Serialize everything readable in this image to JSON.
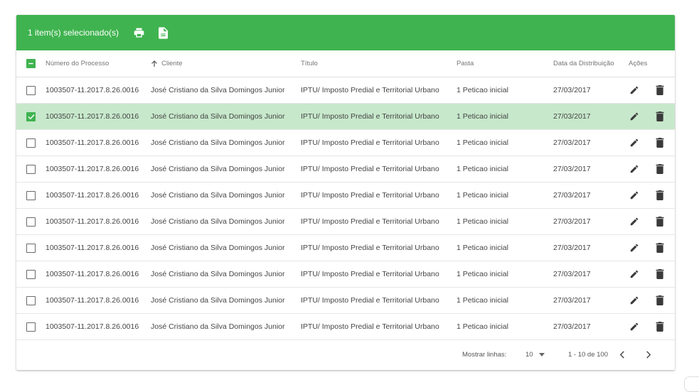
{
  "toolbar": {
    "selected_text": "1 item(s) selecionado(s)",
    "print_icon": "printer-icon",
    "doc_icon": "document-icon",
    "bg_color": "#3fb34f"
  },
  "table": {
    "columns": [
      "Número do Processo",
      "Cliente",
      "Título",
      "Pasta",
      "Data da Distribuição",
      "Ações"
    ],
    "sort_column": "Cliente",
    "sort_icon": "arrow-up-icon",
    "rows": [
      {
        "numero": "1003507-11.2017.8.26.0016",
        "cliente": "José Cristiano da Silva Domingos Junior",
        "titulo": "IPTU/ Imposto Predial e Territorial Urbano",
        "pasta": "1 Peticao inicial",
        "data": "27/03/2017",
        "selected": false
      },
      {
        "numero": "1003507-11.2017.8.26.0016",
        "cliente": "José Cristiano da Silva Domingos Junior",
        "titulo": "IPTU/ Imposto Predial e Territorial Urbano",
        "pasta": "1 Peticao inicial",
        "data": "27/03/2017",
        "selected": true
      },
      {
        "numero": "1003507-11.2017.8.26.0016",
        "cliente": "José Cristiano da Silva Domingos Junior",
        "titulo": "IPTU/ Imposto Predial e Territorial Urbano",
        "pasta": "1 Peticao inicial",
        "data": "27/03/2017",
        "selected": false
      },
      {
        "numero": "1003507-11.2017.8.26.0016",
        "cliente": "José Cristiano da Silva Domingos Junior",
        "titulo": "IPTU/ Imposto Predial e Territorial Urbano",
        "pasta": "1 Peticao inicial",
        "data": "27/03/2017",
        "selected": false
      },
      {
        "numero": "1003507-11.2017.8.26.0016",
        "cliente": "José Cristiano da Silva Domingos Junior",
        "titulo": "IPTU/ Imposto Predial e Territorial Urbano",
        "pasta": "1 Peticao inicial",
        "data": "27/03/2017",
        "selected": false
      },
      {
        "numero": "1003507-11.2017.8.26.0016",
        "cliente": "José Cristiano da Silva Domingos Junior",
        "titulo": "IPTU/ Imposto Predial e Territorial Urbano",
        "pasta": "1 Peticao inicial",
        "data": "27/03/2017",
        "selected": false
      },
      {
        "numero": "1003507-11.2017.8.26.0016",
        "cliente": "José Cristiano da Silva Domingos Junior",
        "titulo": "IPTU/ Imposto Predial e Territorial Urbano",
        "pasta": "1 Peticao inicial",
        "data": "27/03/2017",
        "selected": false
      },
      {
        "numero": "1003507-11.2017.8.26.0016",
        "cliente": "José Cristiano da Silva Domingos Junior",
        "titulo": "IPTU/ Imposto Predial e Territorial Urbano",
        "pasta": "1 Peticao inicial",
        "data": "27/03/2017",
        "selected": false
      },
      {
        "numero": "1003507-11.2017.8.26.0016",
        "cliente": "José Cristiano da Silva Domingos Junior",
        "titulo": "IPTU/ Imposto Predial e Territorial Urbano",
        "pasta": "1 Peticao inicial",
        "data": "27/03/2017",
        "selected": false
      },
      {
        "numero": "1003507-11.2017.8.26.0016",
        "cliente": "José Cristiano da Silva Domingos Junior",
        "titulo": "IPTU/ Imposto Predial e Territorial Urbano",
        "pasta": "1 Peticao inicial",
        "data": "27/03/2017",
        "selected": false
      }
    ],
    "row_action_icons": [
      "edit-pencil-icon",
      "delete-trash-icon"
    ],
    "selected_row_color": "#c7e8cb"
  },
  "pagination": {
    "rows_label": "Mostrar linhas:",
    "rows_per_page": "10",
    "range": "1 - 10 de 100",
    "prev_icon": "chevron-left-icon",
    "next_icon": "chevron-right-icon"
  }
}
